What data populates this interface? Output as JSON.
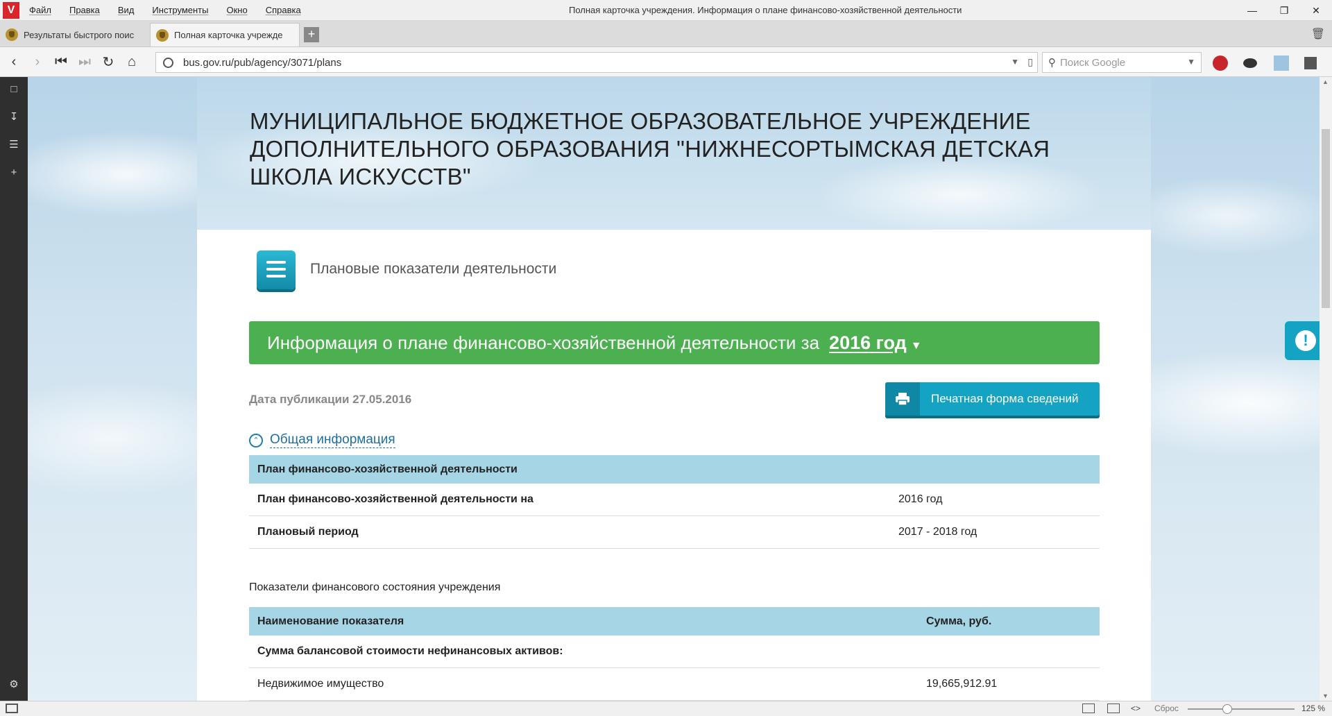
{
  "window": {
    "logo": "V",
    "title": "Полная карточка учреждения. Информация о плане финансово-хозяйственной деятельности",
    "menu": [
      "Файл",
      "Правка",
      "Вид",
      "Инструменты",
      "Окно",
      "Справка"
    ]
  },
  "tabs": [
    {
      "label": "Результаты быстрого поис"
    },
    {
      "label": "Полная карточка учрежде"
    }
  ],
  "address": {
    "url": "bus.gov.ru/pub/agency/3071/plans",
    "search_placeholder": "Поиск Google"
  },
  "page": {
    "org_title": "МУНИЦИПАЛЬНОЕ БЮДЖЕТНОЕ ОБРАЗОВАТЕЛЬНОЕ УЧРЕЖДЕНИЕ ДОПОЛНИТЕЛЬНОГО ОБРАЗОВАНИЯ \"НИЖНЕСОРТЫМСКАЯ ДЕТСКАЯ ШКОЛА ИСКУССТВ\"",
    "section_title": "Плановые показатели деятельности",
    "banner_text": "Информация о плане финансово-хозяйственной деятельности за",
    "banner_year": "2016 год",
    "publication_date": "Дата публикации 27.05.2016",
    "print_button": "Печатная форма сведений",
    "accordion_label": "Общая информация",
    "plan_table": {
      "header": "План финансово-хозяйственной деятельности",
      "rows": [
        {
          "label": "План финансово-хозяйственной деятельности на",
          "value": "2016 год"
        },
        {
          "label": "Плановый период",
          "value": "2017 - 2018 год"
        }
      ]
    },
    "fin_title": "Показатели финансового состояния учреждения",
    "fin_table": {
      "col1": "Наименование показателя",
      "col2": "Сумма, руб.",
      "rows": [
        {
          "label": "Сумма балансовой стоимости нефинансовых активов:",
          "value": ""
        },
        {
          "label": "Недвижимое имущество",
          "value": "19,665,912.91"
        }
      ]
    }
  },
  "status": {
    "reset": "Сброс",
    "zoom": "125 %"
  },
  "colors": {
    "green_banner": "#4cb050",
    "accent_teal": "#14a3c3",
    "table_header": "#a6d6e5"
  }
}
